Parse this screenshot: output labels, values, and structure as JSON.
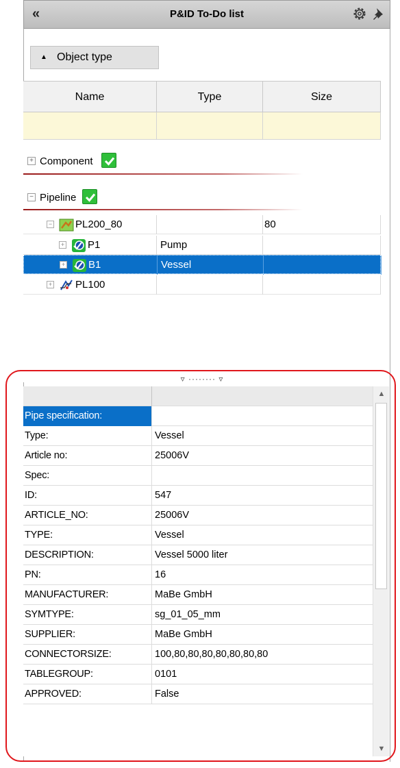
{
  "window": {
    "title": "P&ID To-Do list",
    "collapse_glyph": "«"
  },
  "icons": {
    "settings": "gear-icon",
    "pin": "pin-icon"
  },
  "groupby": {
    "label": "Object type",
    "arrow": "▲"
  },
  "columns": [
    "Name",
    "Type",
    "Size"
  ],
  "groups": [
    {
      "label": "Component",
      "expander": "+"
    },
    {
      "label": "Pipeline",
      "expander": "−"
    }
  ],
  "tree_rows": [
    {
      "name": "PL200_80",
      "type": "",
      "size": "80",
      "expander": "−",
      "icon": "pipeline-assembly-icon"
    },
    {
      "name": "P1",
      "type": "Pump",
      "size": "",
      "expander": "+",
      "icon": "component-status-icon"
    },
    {
      "name": "B1",
      "type": "Vessel",
      "size": "",
      "expander": "+",
      "icon": "component-status-icon",
      "selected": true
    },
    {
      "name": "PL100",
      "type": "",
      "size": "",
      "expander": "+",
      "icon": "pipe-line-icon"
    }
  ],
  "splitter_label": "▿ ········ ▿",
  "properties": [
    {
      "key": "Pipe specification:",
      "value": ""
    },
    {
      "key": "Type:",
      "value": "Vessel"
    },
    {
      "key": "Article no:",
      "value": "25006V"
    },
    {
      "key": "Spec:",
      "value": ""
    },
    {
      "key": "ID:",
      "value": "547"
    },
    {
      "key": "ARTICLE_NO:",
      "value": "25006V"
    },
    {
      "key": "TYPE:",
      "value": "Vessel"
    },
    {
      "key": "DESCRIPTION:",
      "value": "Vessel 5000 liter"
    },
    {
      "key": "PN:",
      "value": "16"
    },
    {
      "key": "MANUFACTURER:",
      "value": "MaBe GmbH"
    },
    {
      "key": "SYMTYPE:",
      "value": "sg_01_05_mm"
    },
    {
      "key": "SUPPLIER:",
      "value": "MaBe GmbH"
    },
    {
      "key": "CONNECTORSIZE:",
      "value": "100,80,80,80,80,80,80,80"
    },
    {
      "key": "TABLEGROUP:",
      "value": "0101"
    },
    {
      "key": "APPROVED:",
      "value": "False"
    }
  ],
  "scroll": {
    "up": "▲",
    "down": "▼"
  },
  "colors": {
    "selection": "#0a6fc8",
    "filter_row": "#fcf8d8",
    "highlight_frame": "#e0161b",
    "check_green": "#2fbf3a"
  }
}
